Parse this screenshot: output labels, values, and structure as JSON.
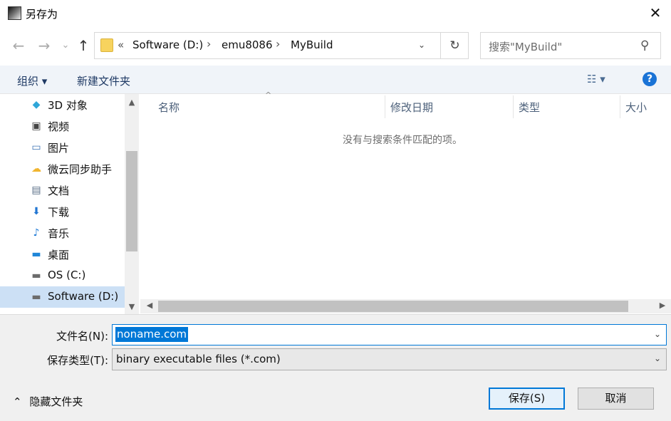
{
  "window": {
    "title": "另存为",
    "close_icon": "close-icon"
  },
  "nav": {
    "back_icon": "←",
    "forward_icon": "→",
    "recent_icon": "⌄",
    "up_icon": "↑"
  },
  "address": {
    "overflow": "«",
    "crumbs": [
      "Software (D:)",
      "emu8086",
      "MyBuild"
    ],
    "separator": "›",
    "dropdown": "⌄",
    "refresh": "↻"
  },
  "search": {
    "placeholder": "搜索\"MyBuild\"",
    "icon": "⚲"
  },
  "toolbar": {
    "organize": "组织 ▾",
    "new_folder": "新建文件夹",
    "view": "☷ ▾",
    "help": "?"
  },
  "sidebar": {
    "items": [
      {
        "label": "3D 对象",
        "icon": "cube-icon",
        "glyph": "◆",
        "color": "#2fa6d8"
      },
      {
        "label": "视频",
        "icon": "video-icon",
        "glyph": "▣",
        "color": "#444444"
      },
      {
        "label": "图片",
        "icon": "picture-icon",
        "glyph": "▭",
        "color": "#3c73b5"
      },
      {
        "label": "微云同步助手",
        "icon": "cloud-icon",
        "glyph": "☁",
        "color": "#f1b530"
      },
      {
        "label": "文档",
        "icon": "document-icon",
        "glyph": "▤",
        "color": "#5a6f88"
      },
      {
        "label": "下载",
        "icon": "download-icon",
        "glyph": "⬇",
        "color": "#2276d2"
      },
      {
        "label": "音乐",
        "icon": "music-icon",
        "glyph": "♪",
        "color": "#1d79d5"
      },
      {
        "label": "桌面",
        "icon": "desktop-icon",
        "glyph": "▬",
        "color": "#1f86d8"
      },
      {
        "label": "OS (C:)",
        "icon": "drive-icon",
        "glyph": "▬",
        "color": "#6c6c6c"
      },
      {
        "label": "Software (D:)",
        "icon": "drive-icon",
        "glyph": "▬",
        "color": "#6c6c6c"
      }
    ],
    "selected_index": 9
  },
  "list": {
    "columns": [
      "名称",
      "修改日期",
      "类型",
      "大小"
    ],
    "empty_message": "没有与搜索条件匹配的项。",
    "sort_indicator": "^"
  },
  "form": {
    "filename_label": "文件名(N):",
    "filename_value": "noname.com",
    "filetype_label": "保存类型(T):",
    "filetype_value": "binary executable files (*.com)"
  },
  "footer": {
    "hide_folders": "隐藏文件夹",
    "hide_chevron": "⌃",
    "save": "保存(S)",
    "cancel": "取消"
  },
  "colors": {
    "accent": "#0078d7",
    "toolbar_bg": "#f0f4f9",
    "selection": "#cce0f5"
  }
}
